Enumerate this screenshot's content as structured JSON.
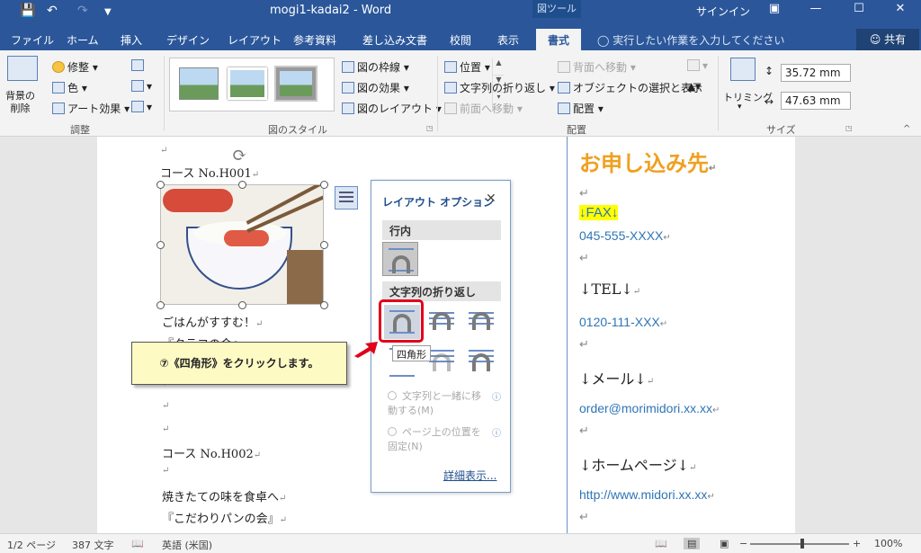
{
  "titlebar": {
    "doc_title": "mogi1-kadai2  -  Word",
    "contextual_label": "図ツール",
    "signin": "サインイン",
    "save_icon": "save-icon",
    "undo_icon": "undo-icon",
    "redo_icon": "redo-icon"
  },
  "tabs": [
    "ファイル",
    "ホーム",
    "挿入",
    "デザイン",
    "レイアウト",
    "参考資料",
    "差し込み文書",
    "校閲",
    "表示",
    "書式"
  ],
  "tellme": "実行したい作業を入力してください",
  "share": "共有",
  "ribbon": {
    "adjust": {
      "remove_bg": "背景の\n削除",
      "corrections": "修整",
      "color": "色",
      "artistic": "アート効果",
      "label": "調整"
    },
    "styles": {
      "border": "図の枠線",
      "effects": "図の効果",
      "layout": "図のレイアウト",
      "label": "図のスタイル"
    },
    "arrange": {
      "position": "位置",
      "wrap": "文字列の折り返し",
      "forward": "前面へ移動",
      "backward": "背面へ移動",
      "selection_pane": "オブジェクトの選択と表示",
      "align": "配置",
      "label": "配置"
    },
    "size": {
      "crop": "トリミング",
      "height": "35.72 mm",
      "width": "47.63 mm",
      "label": "サイズ"
    }
  },
  "doc": {
    "line1": "コース No.H001",
    "line2": "ごはんがすすむ！",
    "line3": "『タラコの会』",
    "line4": "コース No.H002",
    "line5": "焼きたての味を食卓へ",
    "line6": "『こだわりパンの会』"
  },
  "layout_panel": {
    "title": "レイアウト オプション",
    "inline_heading": "行内",
    "wrap_heading": "文字列の折り返し",
    "move_with_text": "文字列と一緒に移\n動する(M)",
    "fix_position": "ページ上の位置を\n固定(N)",
    "detail_link": "詳細表示..."
  },
  "tooltip": "四角形",
  "callout": "⑦《四角形》をクリックします。",
  "right_page": {
    "heading": "お申し込み先",
    "fax_label": "↓FAX↓",
    "fax": "045-555-XXXX",
    "tel_label": "↓TEL↓",
    "tel": "0120-111-XXX",
    "mail_label": "↓メール↓",
    "mail": "order@morimidori.xx.xx",
    "hp_label": "↓ホームページ↓",
    "hp": "http://www.midori.xx.xx"
  },
  "status": {
    "page": "1/2 ページ",
    "words": "387 文字",
    "lang": "英語 (米国)",
    "zoom": "100%"
  },
  "colors": {
    "accent": "#2b579a",
    "heading_orange": "#f0a020",
    "highlight": "#ffff00",
    "callout_red": "#e0001b"
  }
}
